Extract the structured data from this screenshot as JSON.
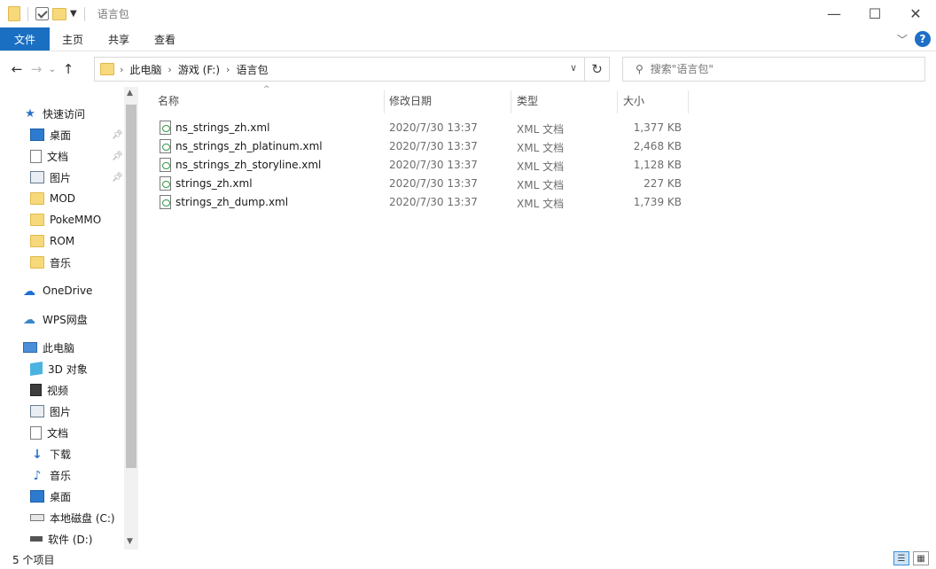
{
  "window": {
    "title": "语言包",
    "controls": {
      "minimize": "—",
      "maximize": "☐",
      "close": "✕"
    }
  },
  "ribbon": {
    "tabs": [
      {
        "label": "文件"
      },
      {
        "label": "主页"
      },
      {
        "label": "共享"
      },
      {
        "label": "查看"
      }
    ],
    "help": "?",
    "expand_icon": "chevron-down-icon"
  },
  "navigation": {
    "path": [
      "此电脑",
      "游戏 (F:)",
      "语言包"
    ],
    "search_placeholder": "搜索\"语言包\""
  },
  "sidebar": {
    "quick_access_label": "快速访问",
    "quick_access": [
      {
        "label": "桌面",
        "pinned": true
      },
      {
        "label": "文档",
        "pinned": true
      },
      {
        "label": "图片",
        "pinned": true
      },
      {
        "label": "MOD"
      },
      {
        "label": "PokeMMO"
      },
      {
        "label": "ROM"
      },
      {
        "label": "音乐"
      }
    ],
    "onedrive_label": "OneDrive",
    "wps_label": "WPS网盘",
    "this_pc_label": "此电脑",
    "this_pc": [
      {
        "label": "3D 对象"
      },
      {
        "label": "视频"
      },
      {
        "label": "图片"
      },
      {
        "label": "文档"
      },
      {
        "label": "下载"
      },
      {
        "label": "音乐"
      },
      {
        "label": "桌面"
      },
      {
        "label": "本地磁盘 (C:)"
      },
      {
        "label": "软件 (D:)"
      }
    ]
  },
  "file_list": {
    "columns": {
      "name": "名称",
      "date": "修改日期",
      "type": "类型",
      "size": "大小"
    },
    "rows": [
      {
        "name": "ns_strings_zh.xml",
        "date": "2020/7/30 13:37",
        "type": "XML 文档",
        "size": "1,377 KB"
      },
      {
        "name": "ns_strings_zh_platinum.xml",
        "date": "2020/7/30 13:37",
        "type": "XML 文档",
        "size": "2,468 KB"
      },
      {
        "name": "ns_strings_zh_storyline.xml",
        "date": "2020/7/30 13:37",
        "type": "XML 文档",
        "size": "1,128 KB"
      },
      {
        "name": "strings_zh.xml",
        "date": "2020/7/30 13:37",
        "type": "XML 文档",
        "size": "227 KB"
      },
      {
        "name": "strings_zh_dump.xml",
        "date": "2020/7/30 13:37",
        "type": "XML 文档",
        "size": "1,739 KB"
      }
    ]
  },
  "status": {
    "item_count": "5 个项目"
  },
  "colors": {
    "file_tab": "#1a6fc2",
    "help_icon": "#1f6fc7",
    "folder": "#f7d97c"
  }
}
